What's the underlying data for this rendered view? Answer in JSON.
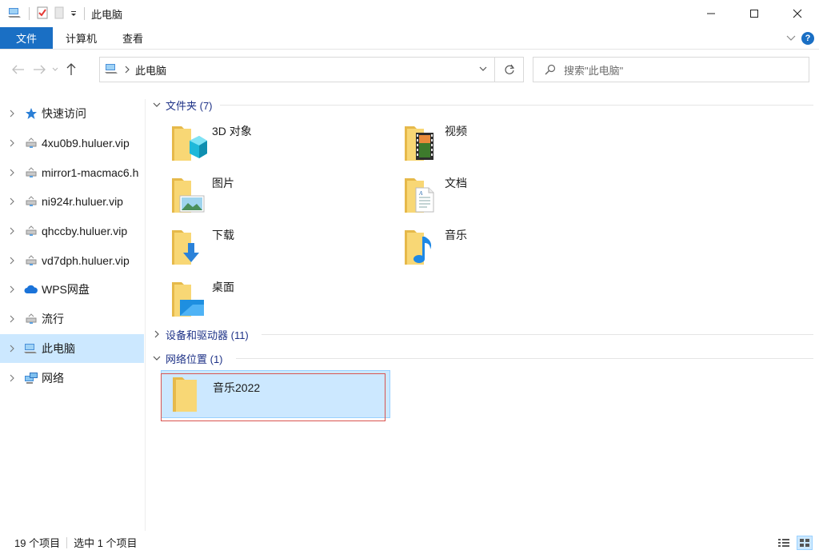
{
  "window": {
    "title": "此电脑"
  },
  "ribbon": {
    "tabs": [
      "文件",
      "计算机",
      "查看"
    ]
  },
  "address": {
    "path": "此电脑"
  },
  "search": {
    "placeholder": "搜索\"此电脑\""
  },
  "sidebar": {
    "items": [
      {
        "label": "快速访问",
        "icon": "star-icon"
      },
      {
        "label": "4xu0b9.huluer.vip",
        "icon": "network-drive-icon"
      },
      {
        "label": "mirror1-macmac6.h",
        "icon": "network-drive-icon"
      },
      {
        "label": "ni924r.huluer.vip",
        "icon": "network-drive-icon"
      },
      {
        "label": "qhccby.huluer.vip",
        "icon": "network-drive-icon"
      },
      {
        "label": "vd7dph.huluer.vip",
        "icon": "network-drive-icon"
      },
      {
        "label": "WPS网盘",
        "icon": "cloud-icon"
      },
      {
        "label": "流行",
        "icon": "network-drive-icon"
      },
      {
        "label": "此电脑",
        "icon": "computer-icon",
        "selected": true
      },
      {
        "label": "网络",
        "icon": "network-icon"
      }
    ]
  },
  "groups": {
    "folders": {
      "label": "文件夹 (7)",
      "expanded": true
    },
    "devices": {
      "label": "设备和驱动器 (11)",
      "expanded": false
    },
    "network": {
      "label": "网络位置 (1)",
      "expanded": true
    }
  },
  "folders": [
    {
      "name": "3D 对象",
      "icon": "3d-objects-folder-icon"
    },
    {
      "name": "视频",
      "icon": "videos-folder-icon"
    },
    {
      "name": "图片",
      "icon": "pictures-folder-icon"
    },
    {
      "name": "文档",
      "icon": "documents-folder-icon"
    },
    {
      "name": "下载",
      "icon": "downloads-folder-icon"
    },
    {
      "name": "音乐",
      "icon": "music-folder-icon"
    },
    {
      "name": "桌面",
      "icon": "desktop-folder-icon"
    }
  ],
  "network_locations": [
    {
      "name": "音乐2022",
      "icon": "folder-icon",
      "selected": true
    }
  ],
  "status": {
    "item_count": "19 个项目",
    "selected_count": "选中 1 个项目"
  },
  "colors": {
    "accent": "#1a6fc4",
    "selection": "#cce8ff",
    "group_header": "#1e3287",
    "folder": "#f8d775",
    "highlight_box": "#d9534f"
  }
}
